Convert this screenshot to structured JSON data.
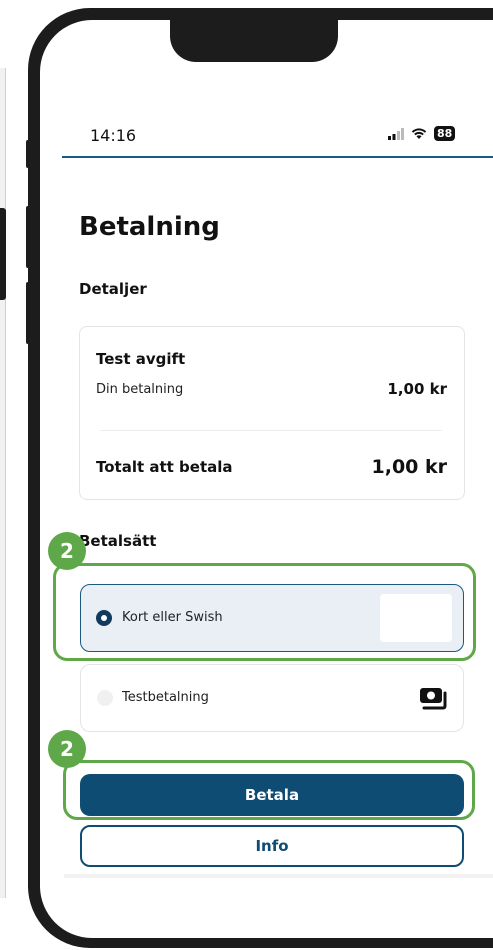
{
  "status_bar": {
    "time": "14:16",
    "battery": "88",
    "signal_icon": "signal-icon",
    "wifi_icon": "wifi-icon"
  },
  "page": {
    "title": "Betalning"
  },
  "details": {
    "heading": "Detaljer",
    "item_name": "Test avgift",
    "row_label": "Din betalning",
    "row_value": "1,00 kr",
    "total_label": "Totalt att betala",
    "total_value": "1,00 kr"
  },
  "payment_methods": {
    "heading": "Betalsätt",
    "options": [
      {
        "label": "Kort eller Swish",
        "selected": true
      },
      {
        "label": "Testbetalning",
        "selected": false,
        "icon": "cash-icon"
      }
    ]
  },
  "badges": {
    "first": "2",
    "second": "2"
  },
  "actions": {
    "pay_label": "Betala",
    "info_label": "Info"
  },
  "colors": {
    "primary": "#0e4c74",
    "highlight": "#5fa84a",
    "selected_bg": "#e9eff5"
  }
}
